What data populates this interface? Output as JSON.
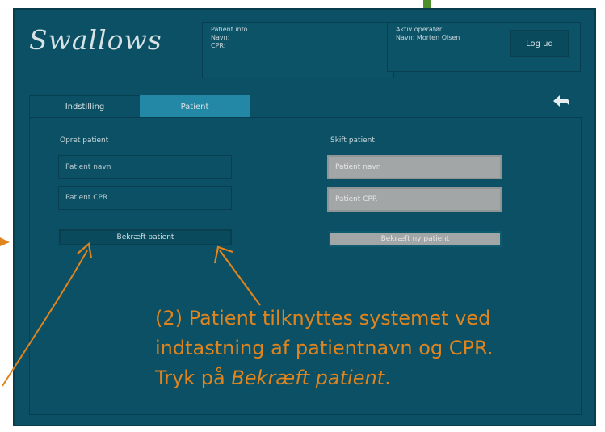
{
  "app": {
    "logo": "Swallows"
  },
  "patient_info": {
    "lines": [
      "Patient info",
      "Navn:",
      "CPR:"
    ]
  },
  "operator_info": {
    "lines": [
      "Aktiv operatør",
      "Navn: Morten Olsen"
    ]
  },
  "header": {
    "logout_label": "Log ud"
  },
  "tabs": [
    {
      "label": "Indstilling",
      "active": false
    },
    {
      "label": "Patient",
      "active": true
    }
  ],
  "new_patient": {
    "heading": "Opret patient",
    "name_placeholder": "Patient navn",
    "cpr_placeholder": "Patient CPR",
    "confirm_label": "Bekræft patient"
  },
  "switch_patient": {
    "heading": "Skift patient",
    "name_placeholder": "Patient navn",
    "cpr_placeholder": "Patient CPR",
    "confirm_label": "Bekræft ny patient"
  },
  "annotation": {
    "line1": "(2) Patient tilknyttes systemet ved",
    "line2": "indtastning af patientnavn og CPR.",
    "line3_prefix": "Tryk på ",
    "line3_emph": "Bekræft patient",
    "line3_suffix": "."
  },
  "colors": {
    "background": "#0b5064",
    "tab_active": "#2387a6",
    "input_disabled": "#a2a6a7",
    "annotation": "#e0841d",
    "logo_text": "#d6e2e5"
  },
  "icons": {
    "back": "back-arrow-icon"
  }
}
